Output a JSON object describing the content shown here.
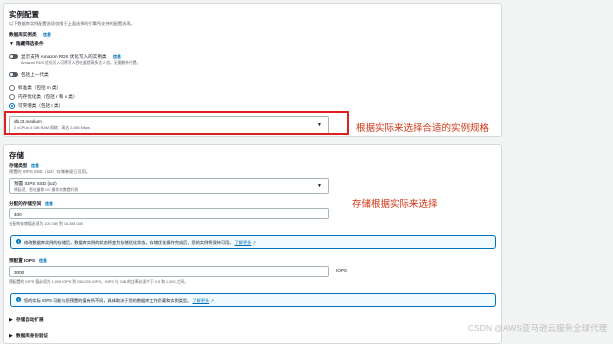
{
  "instance_config": {
    "title": "实例配置",
    "subtitle": "以下数据库实例配置选项仅限于上面选择的引擎所支持的配置选项。",
    "class_label": "数据库实例类",
    "class_info": "信息",
    "filter_toggle": "隐藏筛选条件",
    "filter_option_1": "显示支持 Amazon RDS 优化写入的实例类",
    "filter_option_1_info": "信息",
    "filter_option_1_desc": "Amazon RDS 优化写入可将写入吞吐量提高多达 2 倍，无需额外付费。",
    "filter_option_2": "包括上一代类",
    "radios": [
      {
        "label": "标准类（包括 m 类）",
        "selected": false
      },
      {
        "label": "内存优化类（包括 r 和 x 类）",
        "selected": false
      },
      {
        "label": "可突增类（包括 t 类）",
        "selected": true
      }
    ],
    "selected_class": "db.t3.medium",
    "selected_class_desc": "2 vCPUs    4 GiB RAM    网络：高达 2,085 Mbps"
  },
  "storage": {
    "title": "存储",
    "type_label": "存储类型",
    "type_info": "信息",
    "type_desc": "预置的 IOPS SSD（io2）存储卷现已可用。",
    "type_value": "预置 IOPS SSD (io2)",
    "type_value_desc": "将延迟、吞吐量和 I/O 操作次数提升到",
    "allocated_label": "分配的存储空间",
    "allocated_info": "信息",
    "allocated_value": "400",
    "allocated_hint": "分配的存储值必须为 100 GiB 到 16,384 GiB",
    "alert1_text": "修改数据库实例的存储后，数据库实例的状态将变为存储优化状态。存储优化操作完成后，您的实例将保持可用。",
    "alert1_link": "了解更多",
    "iops_label": "预配置 IOPS",
    "iops_info": "信息",
    "iops_value": "3000",
    "iops_unit": "IOPS",
    "iops_hint": "预配置的 IOPS 值必须为 1,000 IOPS 到 256,000 IOPS，IOPS 与 GiB 的比率必须介于 0.5 和 1,000 之间。",
    "alert2_text": "您的实际 IOPS 可能与您预置的值有所不同，具体取决于您的数据库工作负载和实例类型。",
    "alert2_link": "了解更多",
    "autoscale_toggle": "存储自动扩展",
    "next_toggle": "数据库身份验证"
  },
  "annotations": {
    "instance_note": "根据实际来选择合适的实例规格",
    "storage_note": "存储根据实际来选择"
  },
  "watermark": "CSDN @AWS亚马逊云服务全球代理"
}
